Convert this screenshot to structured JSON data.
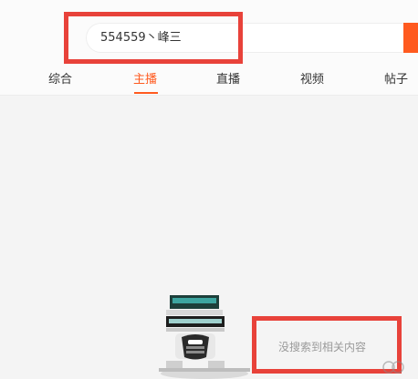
{
  "search": {
    "value": "554559丶峰三"
  },
  "tabs": [
    {
      "label": "综合",
      "active": false
    },
    {
      "label": "主播",
      "active": true
    },
    {
      "label": "直播",
      "active": false
    },
    {
      "label": "视频",
      "active": false
    },
    {
      "label": "帖子",
      "active": false
    }
  ],
  "empty_state": {
    "message": "没搜索到相关内容",
    "illustration": "robot-computer-icon"
  },
  "colors": {
    "accent": "#ff5a1f",
    "highlight": "#e8423a"
  }
}
